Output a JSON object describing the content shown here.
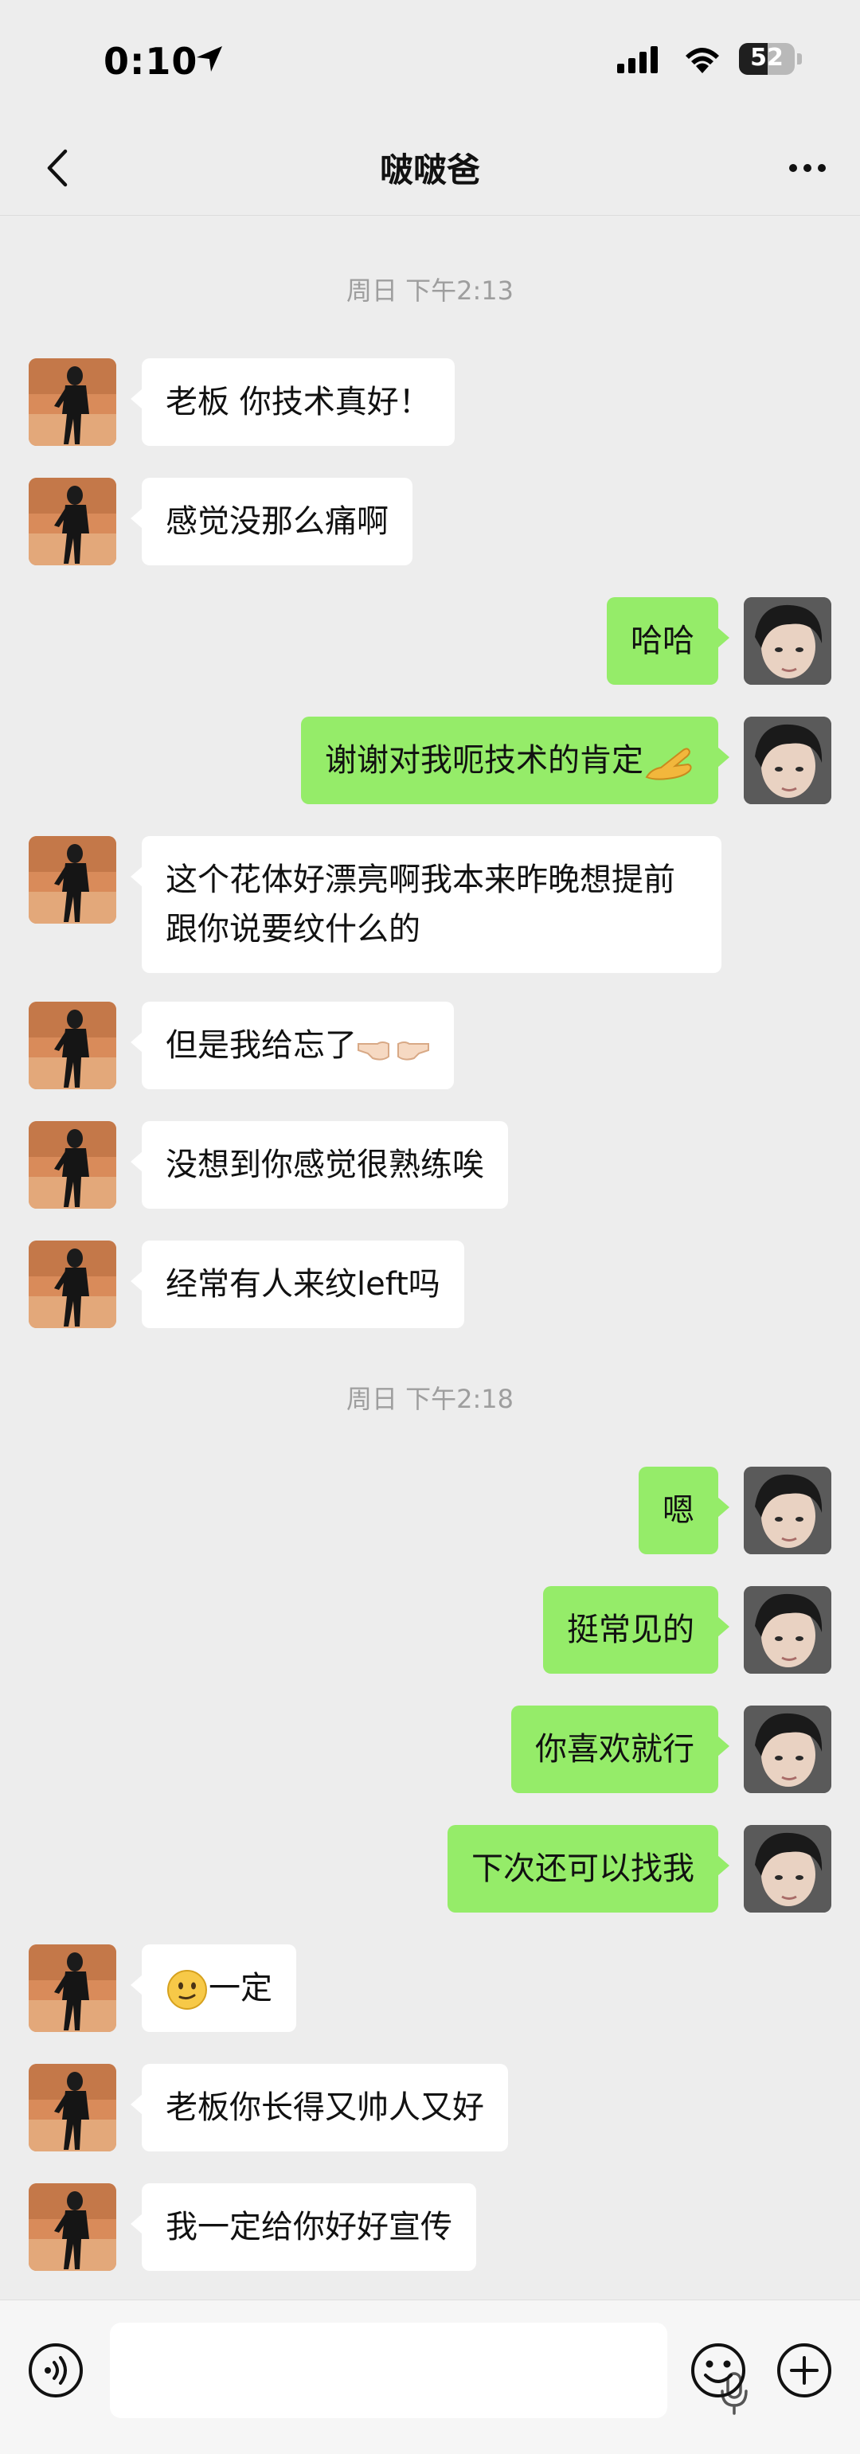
{
  "status": {
    "time": "0:10",
    "battery": "52",
    "battery_level": 0.52
  },
  "header": {
    "title": "啵啵爸"
  },
  "timestamps": {
    "t1": "周日 下午2:13",
    "t2": "周日 下午2:18"
  },
  "messages": {
    "m1": "老板 你技术真好！",
    "m2": "感觉没那么痛啊",
    "m3": "哈哈",
    "m4": "谢谢对我呃技术的肯定",
    "m5": "这个花体好漂亮啊我本来昨晚想提前跟你说要纹什么的",
    "m6": "但是我给忘了",
    "m7": "没想到你感觉很熟练唉",
    "m8": "经常有人来纹left吗",
    "m9": "嗯",
    "m10": "挺常见的",
    "m11": "你喜欢就行",
    "m12": "下次还可以找我",
    "m13": "一定",
    "m14": "老板你长得又帅人又好",
    "m15": "我一定给你好好宣传"
  },
  "colors": {
    "bubble_out": "#95ec69",
    "bubble_in": "#ffffff",
    "background": "#ededed"
  },
  "icons": {
    "m4_emoji": "ok-hand-emoji",
    "m6_emoji": "pointing-fingers-emoji",
    "m13_emoji": "slightly-smiling-face-emoji"
  }
}
